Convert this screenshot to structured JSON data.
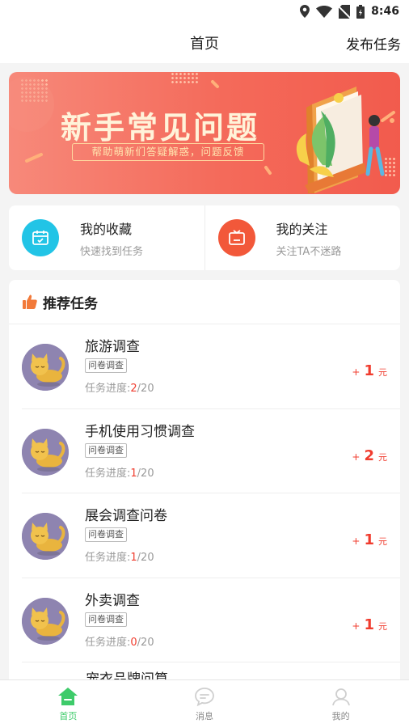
{
  "status_bar": {
    "time": "8:46"
  },
  "header": {
    "title": "首页",
    "action": "发布任务"
  },
  "banner": {
    "title": "新手常见问题",
    "subtitle": "帮助萌新们答疑解惑，问题反馈"
  },
  "quick_links": [
    {
      "title": "我的收藏",
      "desc": "快速找到任务",
      "color": "#22c4e6",
      "icon": "calendar-icon"
    },
    {
      "title": "我的关注",
      "desc": "关注TA不迷路",
      "color": "#f2583a",
      "icon": "tv-icon"
    }
  ],
  "recommend": {
    "title": "推荐任务",
    "tasks": [
      {
        "name": "旅游调查",
        "tag": "问卷调查",
        "progress_label": "任务进度:",
        "done": "2",
        "total": "/20",
        "plus": "+",
        "amount": "1",
        "unit": "元"
      },
      {
        "name": "手机使用习惯调查",
        "tag": "问卷调查",
        "progress_label": "任务进度:",
        "done": "1",
        "total": "/20",
        "plus": "+",
        "amount": "2",
        "unit": "元"
      },
      {
        "name": "展会调查问卷",
        "tag": "问卷调查",
        "progress_label": "任务进度:",
        "done": "1",
        "total": "/20",
        "plus": "+",
        "amount": "1",
        "unit": "元"
      },
      {
        "name": "外卖调查",
        "tag": "问卷调查",
        "progress_label": "任务进度:",
        "done": "0",
        "total": "/20",
        "plus": "+",
        "amount": "1",
        "unit": "元"
      }
    ],
    "partial_next": "宠衣品牌问算"
  },
  "tabbar": [
    {
      "label": "首页",
      "icon": "home-icon",
      "active": true
    },
    {
      "label": "消息",
      "icon": "message-icon",
      "active": false
    },
    {
      "label": "我的",
      "icon": "profile-icon",
      "active": false
    }
  ],
  "colors": {
    "accent_green": "#3ecb6a",
    "reward_red": "#f03c2e",
    "banner_red": "#f46a5a"
  }
}
